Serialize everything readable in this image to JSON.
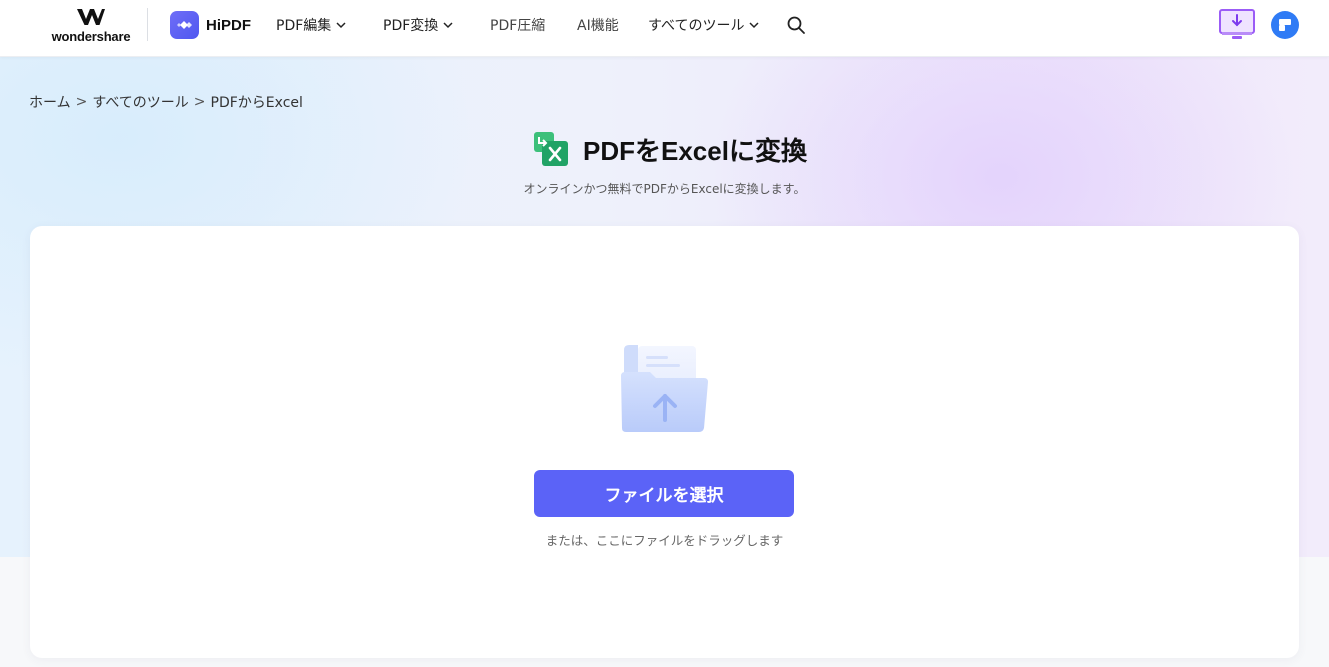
{
  "header": {
    "brand_text": "wondershare",
    "product_name": "HiPDF",
    "nav": [
      {
        "label": "PDF編集",
        "has_dropdown": true
      },
      {
        "label": "PDF変換",
        "has_dropdown": true
      },
      {
        "label": "PDF圧縮",
        "has_dropdown": false
      },
      {
        "label": "AI機能",
        "has_dropdown": false
      },
      {
        "label": "すべてのツール",
        "has_dropdown": true
      }
    ],
    "icons": [
      "search-icon",
      "download-desktop-icon",
      "user-avatar-icon"
    ]
  },
  "breadcrumb": {
    "items": [
      "ホーム",
      "すべてのツール",
      "PDFからExcel"
    ],
    "separator": ">"
  },
  "page": {
    "title": "PDFをExcelに変換",
    "subtitle": "オンラインかつ無料でPDFからExcelに変換します。"
  },
  "upload": {
    "button_label": "ファイルを選択",
    "hint": "または、ここにファイルをドラッグします"
  },
  "colors": {
    "accent": "#5b63f7",
    "excel_green": "#21a366",
    "avatar_blue": "#2f7bf5",
    "download_purple": "#9b5cf6"
  }
}
